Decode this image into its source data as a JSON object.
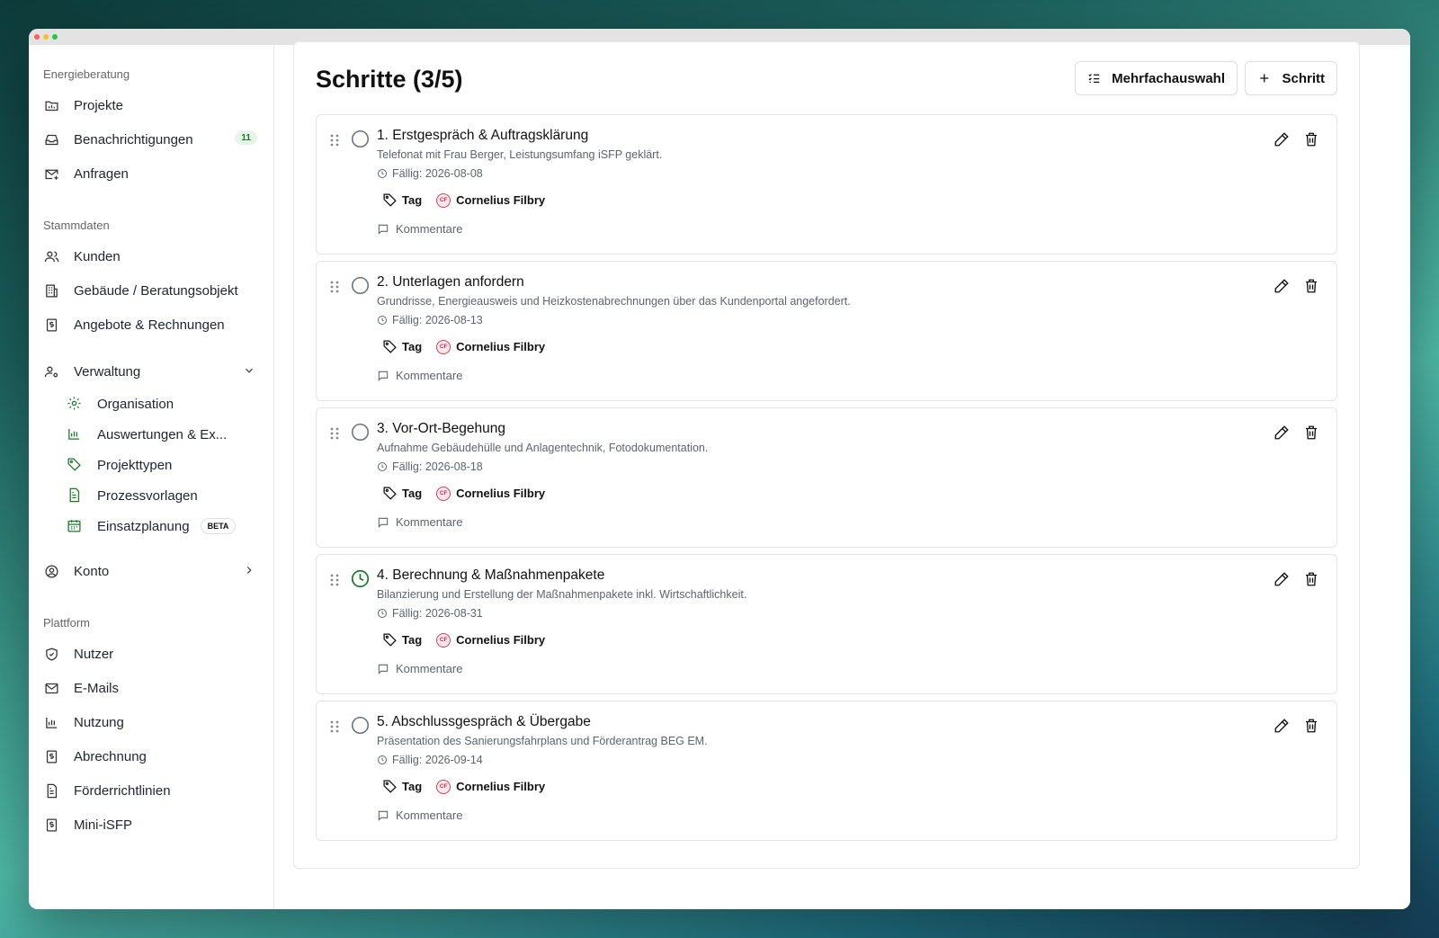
{
  "sidebar": {
    "section_1": "Energieberatung",
    "projects": "Projekte",
    "notifications": "Benachrichtigungen",
    "notifications_count": "11",
    "requests": "Anfragen",
    "section_2": "Stammdaten",
    "customers": "Kunden",
    "buildings": "Gebäude / Beratungsobjekt",
    "offers": "Angebote & Rechnungen",
    "admin": "Verwaltung",
    "admin_items": {
      "organisation": "Organisation",
      "reports": "Auswertungen & Ex...",
      "project_types": "Projekttypen",
      "templates": "Prozessvorlagen",
      "planning": "Einsatzplanung",
      "planning_badge": "BETA"
    },
    "account": "Konto",
    "section_3": "Plattform",
    "users": "Nutzer",
    "emails": "E-Mails",
    "usage": "Nutzung",
    "billing": "Abrechnung",
    "funding": "Förderrichtlinien",
    "mini_isfp": "Mini-iSFP"
  },
  "header": {
    "title": "Schritte (3/5)",
    "multi_select": "Mehrfachauswahl",
    "add_step": "Schritt"
  },
  "steps": [
    {
      "title": "1. Erstgespräch & Auftragsklärung",
      "desc": "Telefonat mit Frau Berger, Leistungsumfang iSFP geklärt.",
      "due": "Fällig: 2026-08-08",
      "tag": "Tag",
      "assignee_initials": "CF",
      "assignee": "Cornelius Filbry",
      "comments": "Kommentare",
      "status": "open"
    },
    {
      "title": "2. Unterlagen anfordern",
      "desc": "Grundrisse, Energieausweis und Heizkostenabrechnungen über das Kundenportal angefordert.",
      "due": "Fällig: 2026-08-13",
      "tag": "Tag",
      "assignee_initials": "CF",
      "assignee": "Cornelius Filbry",
      "comments": "Kommentare",
      "status": "open"
    },
    {
      "title": "3. Vor-Ort-Begehung",
      "desc": "Aufnahme Gebäudehülle und Anlagentechnik, Fotodokumentation.",
      "due": "Fällig: 2026-08-18",
      "tag": "Tag",
      "assignee_initials": "CF",
      "assignee": "Cornelius Filbry",
      "comments": "Kommentare",
      "status": "open"
    },
    {
      "title": "4. Berechnung & Maßnahmenpakete",
      "desc": "Bilanzierung und Erstellung der Maßnahmenpakete inkl. Wirtschaftlichkeit.",
      "due": "Fällig: 2026-08-31",
      "tag": "Tag",
      "assignee_initials": "CF",
      "assignee": "Cornelius Filbry",
      "comments": "Kommentare",
      "status": "in-progress"
    },
    {
      "title": "5. Abschlussgespräch & Übergabe",
      "desc": "Präsentation des Sanierungsfahrplans und Förderantrag BEG EM.",
      "due": "Fällig: 2026-09-14",
      "tag": "Tag",
      "assignee_initials": "CF",
      "assignee": "Cornelius Filbry",
      "comments": "Kommentare",
      "status": "open"
    }
  ],
  "colors": {
    "accent": "#1b7a2a",
    "avatar": "#d0405c"
  }
}
